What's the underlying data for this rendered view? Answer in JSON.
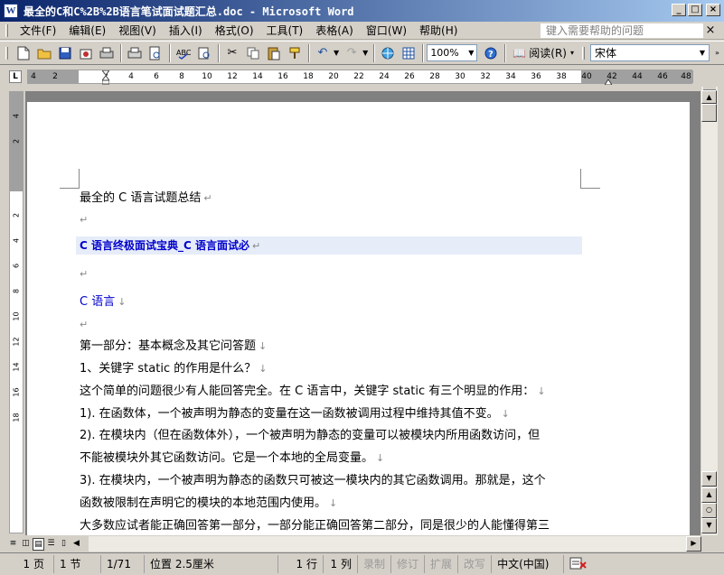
{
  "window": {
    "title": "最全的C和C%2B%2B语言笔试面试题汇总.doc - Microsoft Word",
    "app_icon": "W"
  },
  "menu": {
    "items": [
      "文件(F)",
      "编辑(E)",
      "视图(V)",
      "插入(I)",
      "格式(O)",
      "工具(T)",
      "表格(A)",
      "窗口(W)",
      "帮助(H)"
    ],
    "help_placeholder": "键入需要帮助的问题"
  },
  "toolbar": {
    "zoom": "100%",
    "read_label": "阅读(R)",
    "font": "宋体"
  },
  "ruler": {
    "corner": "L",
    "h_ticks": [
      "4",
      "2",
      "2",
      "4",
      "6",
      "8",
      "10",
      "12",
      "14",
      "16",
      "18",
      "20",
      "22",
      "24",
      "26",
      "28",
      "30",
      "32",
      "34",
      "36",
      "38",
      "40",
      "42",
      "44",
      "46",
      "48"
    ],
    "v_ticks": [
      "4",
      "2",
      "2",
      "4",
      "6",
      "8",
      "10",
      "12",
      "14",
      "16",
      "18"
    ]
  },
  "document": {
    "lines": [
      {
        "text": "最全的 C 语言试题总结",
        "style": "normal"
      },
      {
        "text": "",
        "style": "normal"
      },
      {
        "text": "C 语言终极面试宝典_C 语言面试必",
        "style": "bold-blue"
      },
      {
        "text": "",
        "style": "normal"
      },
      {
        "text": "C 语言",
        "style": "blue"
      },
      {
        "text": "",
        "style": "normal"
      },
      {
        "text": "第一部分：基本概念及其它问答题",
        "style": "normal"
      },
      {
        "text": "1、关键字 static 的作用是什么？",
        "style": "normal"
      },
      {
        "text": "这个简单的问题很少有人能回答完全。在 C 语言中，关键字 static 有三个明显的作用：",
        "style": "normal"
      },
      {
        "text": "1). 在函数体，一个被声明为静态的变量在这一函数被调用过程中维持其值不变。",
        "style": "normal"
      },
      {
        "text": "2). 在模块内（但在函数体外），一个被声明为静态的变量可以被模块内所用函数访问，但",
        "style": "normal"
      },
      {
        "text": "不能被模块外其它函数访问。它是一个本地的全局变量。",
        "style": "normal"
      },
      {
        "text": "3). 在模块内，一个被声明为静态的函数只可被这一模块内的其它函数调用。那就是，这个",
        "style": "normal"
      },
      {
        "text": "函数被限制在声明它的模块的本地范围内使用。",
        "style": "normal"
      },
      {
        "text": "大多数应试者能正确回答第一部分，一部分能正确回答第二部分，同是很少的人能懂得第三",
        "style": "normal"
      }
    ]
  },
  "status": {
    "page": "1 页",
    "section": "1 节",
    "page_of": "1/71",
    "position": "位置 2.5厘米",
    "line": "1 行",
    "col": "1 列",
    "rec": "录制",
    "trk": "修订",
    "ext": "扩展",
    "ovr": "改写",
    "lang": "中文(中国)"
  }
}
